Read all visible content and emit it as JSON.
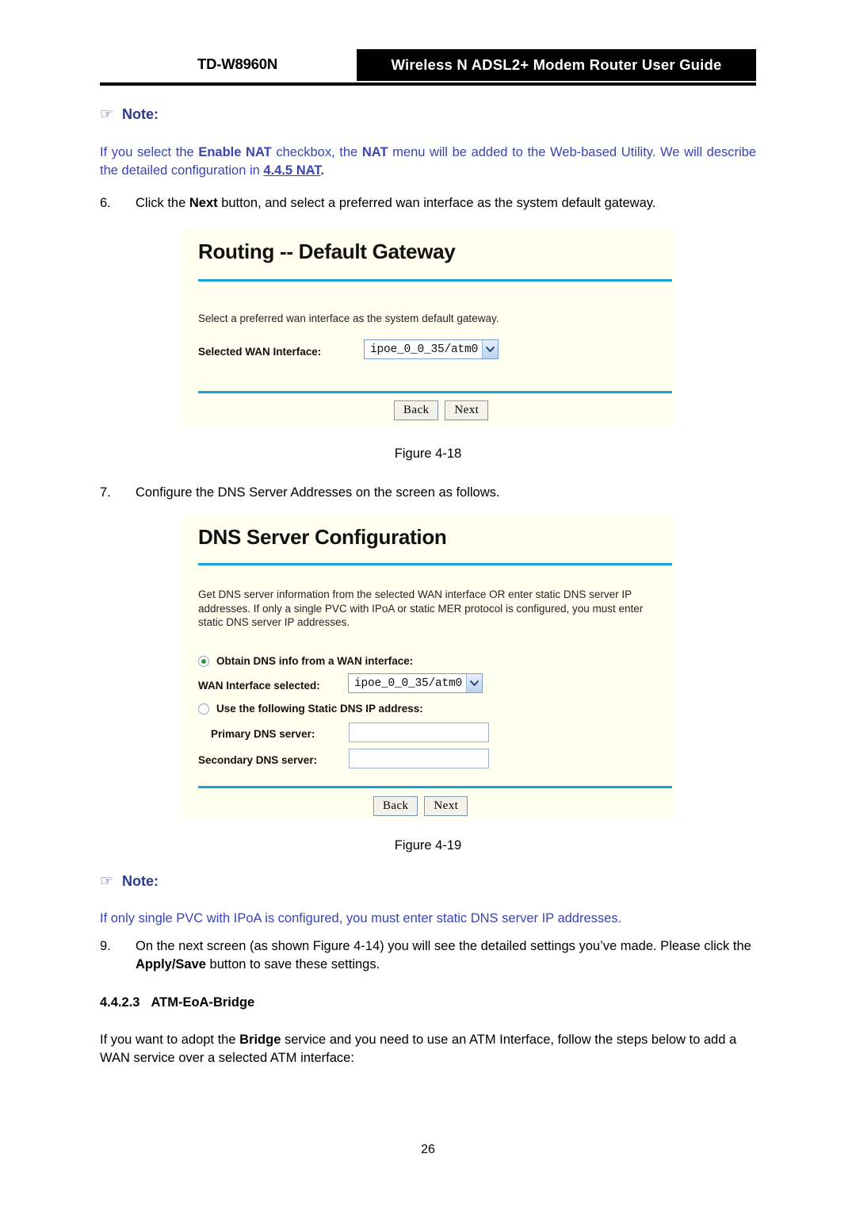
{
  "header": {
    "model": "TD-W8960N",
    "title": "Wireless N ADSL2+ Modem Router User Guide"
  },
  "note1": {
    "icon": "pointing-hand-icon",
    "label": "Note:",
    "text_before": "If you select the ",
    "bold1": "Enable NAT",
    "text_mid1": " checkbox, the ",
    "bold2": "NAT",
    "text_mid2": " menu will be added to the Web-based Utility. We will describe the detailed configuration in ",
    "link": "4.4.5 NAT",
    "text_after": "."
  },
  "step6": {
    "number": "6.",
    "text_before": "Click the ",
    "bold": "Next",
    "text_after": " button, and select a preferred wan interface as the system default gateway."
  },
  "figure18": {
    "caption": "Figure 4-18",
    "title": "Routing -- Default Gateway",
    "description": "Select a preferred wan interface as the system default gateway.",
    "wan_label": "Selected WAN Interface:",
    "wan_value": "ipoe_0_0_35/atm0",
    "back_label": "Back",
    "next_label": "Next"
  },
  "step7": {
    "number": "7.",
    "text": "Configure the DNS Server Addresses on the screen as follows."
  },
  "figure19": {
    "caption": "Figure 4-19",
    "title": "DNS Server Configuration",
    "description": "Get DNS server information from the selected WAN interface OR enter static DNS server IP addresses. If only a single PVC with IPoA or static MER protocol is configured, you must enter static DNS server IP addresses.",
    "radio_obtain_label": "Obtain DNS info from a WAN interface:",
    "radio_obtain_selected": true,
    "wan_label": "WAN Interface selected:",
    "wan_value": "ipoe_0_0_35/atm0",
    "radio_static_label": "Use the following Static DNS IP address:",
    "radio_static_selected": false,
    "primary_label": "Primary DNS server:",
    "primary_value": "",
    "secondary_label": "Secondary DNS server:",
    "secondary_value": "",
    "back_label": "Back",
    "next_label": "Next"
  },
  "note2": {
    "icon": "pointing-hand-icon",
    "label": "Note:",
    "text": "If only single PVC with IPoA is configured, you must enter static DNS server IP addresses."
  },
  "step9": {
    "number": "9.",
    "text_before": "On the next screen (as shown Figure 4-14) you will see the detailed settings you’ve made. Please click the ",
    "bold": "Apply/Save",
    "text_after": " button to save these settings."
  },
  "section": {
    "number": "4.4.2.3",
    "title": "ATM-EoA-Bridge"
  },
  "body_para": {
    "text_before": "If you want to adopt the ",
    "bold": "Bridge",
    "text_after": " service and you need to use an ATM Interface, follow the steps below to add a WAN service over a selected ATM interface:"
  },
  "footer": {
    "page_number": "26"
  },
  "colors": {
    "note_blue": "#3a44b0",
    "note_head_blue": "#2b3a8f",
    "figure_bg": "#fffff0",
    "figure_rule": "#18a4d4",
    "radio_dot_green": "#2f9a33"
  }
}
